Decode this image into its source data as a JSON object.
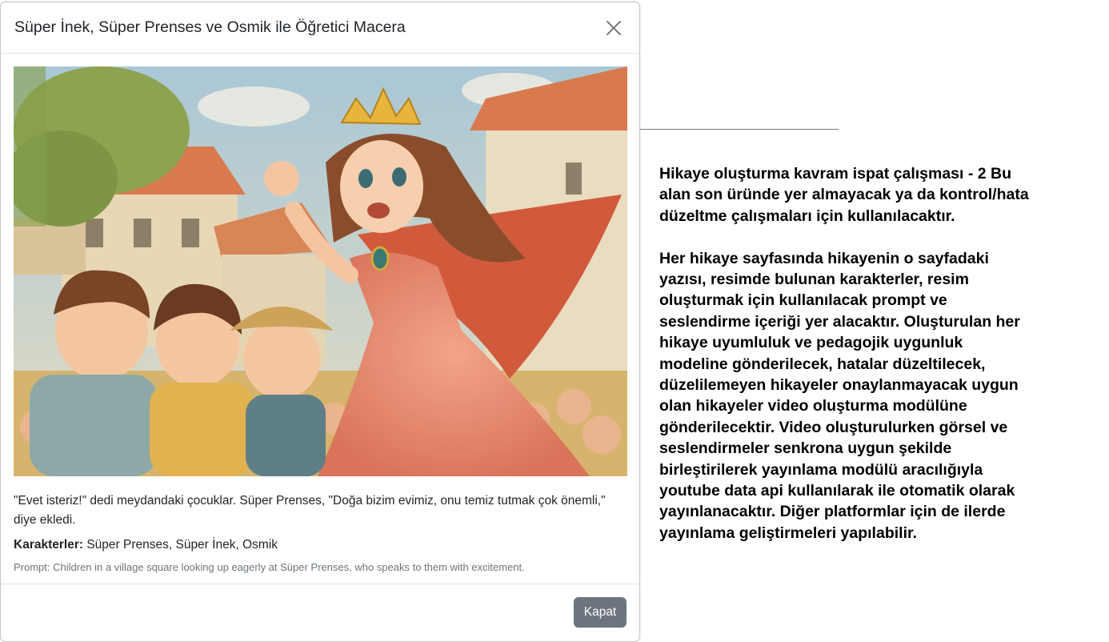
{
  "modal": {
    "title": "Süper İnek, Süper Prenses ve Osmik ile Öğretici Macera",
    "close_icon": "close-icon",
    "story_text": "\"Evet isteriz!\" dedi meydandaki çocuklar. Süper Prenses, \"Doğa bizim evimiz, onu temiz tutmak çok önemli,\" diye ekledi.",
    "characters_label": "Karakterler:",
    "characters_value": " Süper Prenses, Süper İnek, Osmik",
    "prompt_text": "Prompt: Children in a village square looking up eagerly at Süper Prenses, who speaks to them with excitement.",
    "footer_button": "Kapat"
  },
  "info_panel": {
    "paragraph1": "Hikaye oluşturma kavram ispat çalışması - 2 Bu alan son üründe yer almayacak ya da kontrol/hata düzeltme çalışmaları için kullanılacaktır.",
    "paragraph2": "Her hikaye sayfasında hikayenin o sayfadaki yazısı, resimde bulunan karakterler, resim oluşturmak için kullanılacak prompt ve seslendirme içeriği yer alacaktır. Oluşturulan her hikaye uyumluluk ve pedagojik uygunluk modeline gönderilecek, hatalar düzeltilecek, düzelilemeyen hikayeler onaylanmayacak uygun olan hikayeler video oluşturma modülüne gönderilecektir. Video oluşturulurken görsel ve seslendirmeler senkrona uygun şekilde birleştirilerek yayınlama modülü aracılığıyla youtube data api kullanılarak ile otomatik olarak yayınlanacaktır. Diğer platformlar için de ilerde yayınlama geliştirmeleri yapılabilir."
  },
  "colors": {
    "secondary_button": "#6c757d",
    "muted_text": "#6c757d",
    "border": "#dee2e6"
  }
}
